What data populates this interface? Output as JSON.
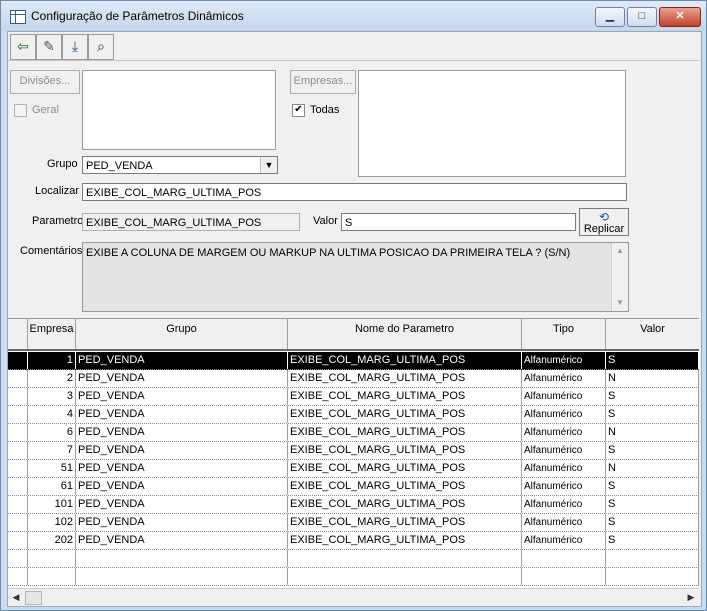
{
  "window": {
    "title": "Configuração de Parâmetros Dinâmicos",
    "minimize": "▁",
    "maximize": "□",
    "close": "✕"
  },
  "toolbar": {
    "icons": [
      "exit-door-icon",
      "eraser-icon",
      "save-download-icon",
      "binoculars-icon"
    ],
    "glyphs": [
      "⇦",
      "✎",
      "⤓",
      "⌕"
    ]
  },
  "divisoes": {
    "label": "Divisões...",
    "geral_label": "Geral",
    "geral_checked": false
  },
  "empresas": {
    "label": "Empresas...",
    "todas_label": "Todas",
    "todas_checked": true,
    "check_glyph": "✔"
  },
  "grupo": {
    "label": "Grupo",
    "value": "PED_VENDA",
    "arrow": "▼"
  },
  "localizar": {
    "label": "Localizar",
    "value": "EXIBE_COL_MARG_ULTIMA_POS"
  },
  "parametro": {
    "label": "Parametro",
    "value": "EXIBE_COL_MARG_ULTIMA_POS"
  },
  "valor": {
    "label": "Valor",
    "value": "S"
  },
  "replicar": {
    "label": "Replicar",
    "icon": "⟲"
  },
  "comentarios": {
    "label": "Comentários",
    "text": "EXIBE A COLUNA DE MARGEM OU MARKUP NA ULTIMA POSICAO DA PRIMEIRA TELA ? (S/N)"
  },
  "grid": {
    "columns": [
      "Empresa",
      "Grupo",
      "Nome do Parametro",
      "Tipo",
      "Valor"
    ],
    "rows": [
      {
        "empresa": "1",
        "grupo": "PED_VENDA",
        "nome": "EXIBE_COL_MARG_ULTIMA_POS",
        "tipo": "Alfanumérico",
        "valor": "S"
      },
      {
        "empresa": "2",
        "grupo": "PED_VENDA",
        "nome": "EXIBE_COL_MARG_ULTIMA_POS",
        "tipo": "Alfanumérico",
        "valor": "N"
      },
      {
        "empresa": "3",
        "grupo": "PED_VENDA",
        "nome": "EXIBE_COL_MARG_ULTIMA_POS",
        "tipo": "Alfanumérico",
        "valor": "S"
      },
      {
        "empresa": "4",
        "grupo": "PED_VENDA",
        "nome": "EXIBE_COL_MARG_ULTIMA_POS",
        "tipo": "Alfanumérico",
        "valor": "S"
      },
      {
        "empresa": "6",
        "grupo": "PED_VENDA",
        "nome": "EXIBE_COL_MARG_ULTIMA_POS",
        "tipo": "Alfanumérico",
        "valor": "N"
      },
      {
        "empresa": "7",
        "grupo": "PED_VENDA",
        "nome": "EXIBE_COL_MARG_ULTIMA_POS",
        "tipo": "Alfanumérico",
        "valor": "S"
      },
      {
        "empresa": "51",
        "grupo": "PED_VENDA",
        "nome": "EXIBE_COL_MARG_ULTIMA_POS",
        "tipo": "Alfanumérico",
        "valor": "N"
      },
      {
        "empresa": "61",
        "grupo": "PED_VENDA",
        "nome": "EXIBE_COL_MARG_ULTIMA_POS",
        "tipo": "Alfanumérico",
        "valor": "S"
      },
      {
        "empresa": "101",
        "grupo": "PED_VENDA",
        "nome": "EXIBE_COL_MARG_ULTIMA_POS",
        "tipo": "Alfanumérico",
        "valor": "S"
      },
      {
        "empresa": "102",
        "grupo": "PED_VENDA",
        "nome": "EXIBE_COL_MARG_ULTIMA_POS",
        "tipo": "Alfanumérico",
        "valor": "S"
      },
      {
        "empresa": "202",
        "grupo": "PED_VENDA",
        "nome": "EXIBE_COL_MARG_ULTIMA_POS",
        "tipo": "Alfanumérico",
        "valor": "S"
      }
    ]
  },
  "scroll": {
    "left": "◀",
    "right": "▶",
    "up": "▲",
    "down": "▼"
  }
}
